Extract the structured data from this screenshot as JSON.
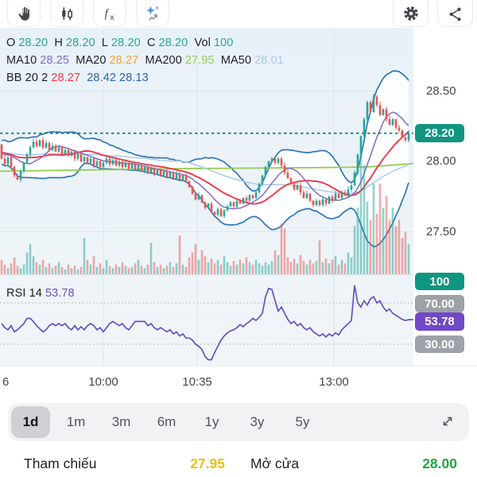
{
  "toolbar": {
    "icons": [
      "pan-hand",
      "candlestick-style",
      "function-fx",
      "ai-sparkles",
      "settings-gear",
      "share"
    ]
  },
  "legend": {
    "row1": {
      "o_label": "O",
      "o": "28.20",
      "h_label": "H",
      "h": "28.20",
      "l_label": "L",
      "l": "28.20",
      "c_label": "C",
      "c": "28.20",
      "vol_label": "Vol",
      "vol": "100"
    },
    "row2": [
      {
        "label": "MA10",
        "value": "28.25"
      },
      {
        "label": "MA20",
        "value": "28.27"
      },
      {
        "label": "MA200",
        "value": "27.95"
      },
      {
        "label": "MA50",
        "value": "28.01"
      }
    ],
    "row3": {
      "label": "BB 20 2",
      "basis": "28.27",
      "upper": "28.42",
      "lower": "28.13"
    },
    "rsi_label": "RSI 14",
    "rsi_value": "53.78"
  },
  "axis": {
    "price_labels": [
      "28.50",
      "28.00",
      "27.50"
    ],
    "price_badge": "28.20",
    "volume_badge": "100",
    "rsi_upper_badge": "70.00",
    "rsi_value_badge": "53.78",
    "rsi_lower_badge": "30.00",
    "time_labels": [
      "6",
      "10:00",
      "10:35",
      "13:00"
    ]
  },
  "timeframes": {
    "options": [
      "1d",
      "1m",
      "3m",
      "6m",
      "1y",
      "3y",
      "5y"
    ],
    "selected": "1d"
  },
  "footer": [
    {
      "label": "Tham chiếu",
      "value": "27.95"
    },
    {
      "label": "Mở cửa",
      "value": "28.00"
    }
  ],
  "colors": {
    "up": "#26a69a",
    "down": "#ef5350",
    "badge_teal": "#0f9680",
    "badge_gray": "#9da1a8",
    "badge_purple": "#7148c8",
    "bb_line": "#2f77b6",
    "bb_fill": "#ffffff",
    "bb_value": "#2a66ad",
    "ma10": "#7e6bc8",
    "ma20_line": "#f23645",
    "ma20_value": "#f2a33c",
    "ma50": "#a8cbe8",
    "ma200": "#93cc4e",
    "rsi_line": "#6a51c0",
    "price_dash": "#0d7d6f",
    "grid": "#dce6ee",
    "chart_bg_top": "#e8f1f8",
    "chart_bg_bot": "#f0f5f8",
    "gold": "#edbf12",
    "open_green": "#1fa83d",
    "text_dark": "#1d1f24",
    "text_gray": "#45474e",
    "icon": "#45474c"
  },
  "chart_data": {
    "type": "candlestick",
    "title": "Intraday price chart with MA10/MA20/MA50/MA200, Bollinger Bands (20,2), volume and RSI 14",
    "price_axis": {
      "visible_labels": [
        28.5,
        28.0,
        27.5
      ],
      "last_price": 28.2,
      "ylim": [
        27.45,
        28.65
      ]
    },
    "rsi_axis": {
      "levels": [
        70,
        30
      ],
      "last_value": 53.78
    },
    "volume_last": 100,
    "time_labels": [
      "6",
      "10:00",
      "10:35",
      "13:00"
    ],
    "closes": [
      28.02,
      27.98,
      28.03,
      27.96,
      27.9,
      27.87,
      27.93,
      27.99,
      28.05,
      28.1,
      28.14,
      28.11,
      28.15,
      28.1,
      28.13,
      28.08,
      28.11,
      28.07,
      28.1,
      28.05,
      28.08,
      28.04,
      28.07,
      28.02,
      28.05,
      28.0,
      28.03,
      27.99,
      28.02,
      27.97,
      28.0,
      27.96,
      27.99,
      28.02,
      27.98,
      28.01,
      27.97,
      28.0,
      27.96,
      27.99,
      27.95,
      27.98,
      27.94,
      27.97,
      27.93,
      27.96,
      27.92,
      27.95,
      27.91,
      27.94,
      27.9,
      27.93,
      27.89,
      27.92,
      27.88,
      27.91,
      27.87,
      27.9,
      27.86,
      27.82,
      27.77,
      27.73,
      27.76,
      27.71,
      27.67,
      27.7,
      27.64,
      27.62,
      27.66,
      27.61,
      27.65,
      27.68,
      27.71,
      27.68,
      27.72,
      27.7,
      27.74,
      27.72,
      27.76,
      27.74,
      27.78,
      27.84,
      27.9,
      27.96,
      28.0,
      28.02,
      27.99,
      28.02,
      27.97,
      27.92,
      27.88,
      27.84,
      27.8,
      27.83,
      27.78,
      27.74,
      27.77,
      27.72,
      27.69,
      27.72,
      27.69,
      27.73,
      27.7,
      27.75,
      27.72,
      27.77,
      27.74,
      27.78,
      27.76,
      27.8,
      27.83,
      27.92,
      28.05,
      28.18,
      28.3,
      28.42,
      28.35,
      28.46,
      28.4,
      28.33,
      28.37,
      28.3,
      28.26,
      28.3,
      28.24,
      28.22,
      28.17,
      28.15,
      28.2
    ],
    "volumes": [
      12,
      8,
      5,
      9,
      14,
      7,
      5,
      8,
      18,
      25,
      15,
      10,
      8,
      12,
      6,
      9,
      5,
      7,
      10,
      6,
      4,
      8,
      5,
      7,
      4,
      6,
      30,
      12,
      8,
      15,
      6,
      9,
      5,
      12,
      7,
      5,
      8,
      6,
      10,
      7,
      5,
      6,
      9,
      12,
      7,
      5,
      8,
      26,
      10,
      6,
      8,
      5,
      7,
      10,
      6,
      9,
      32,
      8,
      6,
      14,
      18,
      25,
      12,
      20,
      15,
      10,
      13,
      9,
      12,
      8,
      15,
      10,
      7,
      11,
      8,
      12,
      9,
      14,
      10,
      8,
      12,
      9,
      7,
      10,
      8,
      11,
      20,
      16,
      42,
      38,
      14,
      10,
      13,
      9,
      16,
      11,
      8,
      12,
      9,
      11,
      28,
      10,
      13,
      9,
      12,
      15,
      8,
      12,
      9,
      18,
      14,
      40,
      55,
      100,
      90,
      60,
      45,
      75,
      50,
      75,
      55,
      65,
      45,
      55,
      40,
      45,
      30,
      35,
      25
    ],
    "rsi": [
      50,
      46,
      44,
      48,
      42,
      44,
      47,
      50,
      55,
      55,
      52,
      48,
      45,
      42,
      44,
      48,
      50,
      48,
      50,
      48,
      50,
      46,
      44,
      48,
      44,
      47,
      44,
      48,
      50,
      48,
      44,
      46,
      42,
      46,
      50,
      52,
      50,
      48,
      50,
      46,
      44,
      48,
      52,
      52,
      52,
      52,
      48,
      50,
      46,
      44,
      46,
      44,
      42,
      44,
      40,
      42,
      38,
      40,
      36,
      36,
      34,
      30,
      28,
      25,
      18,
      15,
      15,
      22,
      28,
      34,
      38,
      41,
      43,
      44,
      46,
      49,
      47,
      50,
      52,
      55,
      53,
      56,
      60,
      76,
      84,
      83,
      72,
      62,
      66,
      60,
      54,
      50,
      52,
      48,
      50,
      46,
      44,
      46,
      42,
      40,
      38,
      40,
      37,
      40,
      38,
      41,
      39,
      44,
      47,
      50,
      53,
      87,
      70,
      66,
      72,
      68,
      74,
      76,
      70,
      72,
      66,
      62,
      64,
      60,
      58,
      56,
      54,
      53,
      53.78
    ],
    "ma200_points": [
      [
        0,
        27.93
      ],
      [
        120,
        27.94
      ],
      [
        250,
        27.95
      ],
      [
        380,
        27.955
      ],
      [
        460,
        27.96
      ],
      [
        520,
        27.985
      ]
    ],
    "indicators": [
      "MA10",
      "MA20",
      "MA50",
      "MA200",
      "BB 20 2",
      "RSI 14"
    ],
    "legend_position": "top-left",
    "grid": true
  }
}
